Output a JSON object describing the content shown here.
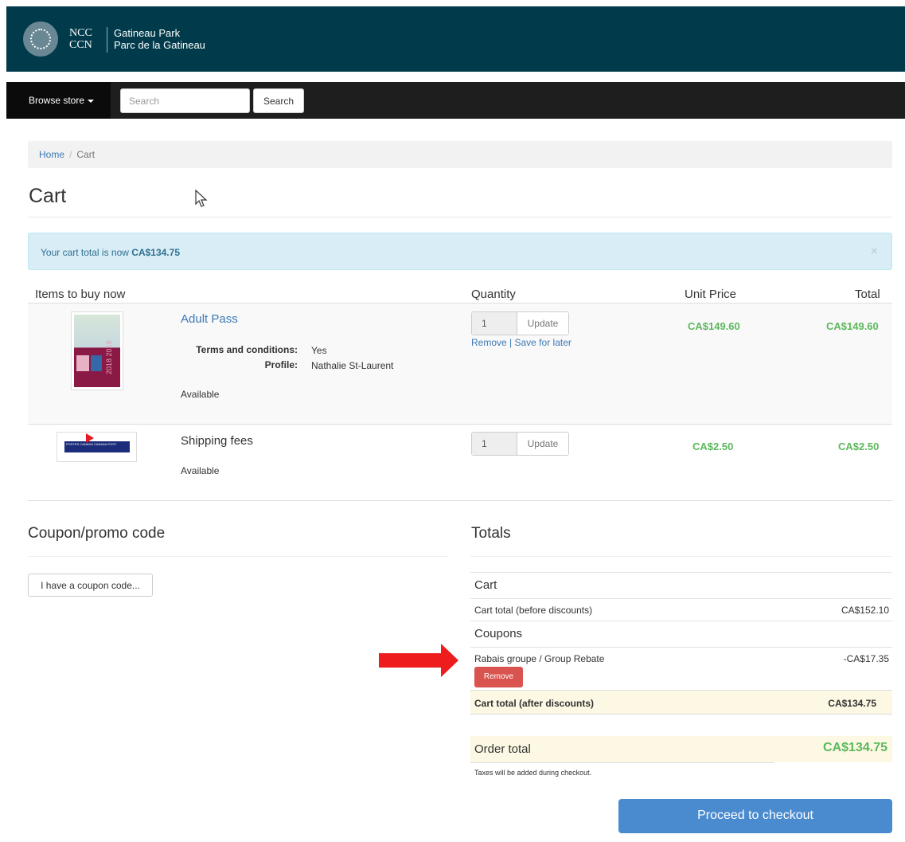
{
  "header": {
    "logo_top": "NCC",
    "logo_bottom": "CCN",
    "park_en": "Gatineau Park",
    "park_fr": "Parc de la Gatineau"
  },
  "nav": {
    "browse_label": "Browse store",
    "search_placeholder": "Search",
    "search_button": "Search"
  },
  "breadcrumb": {
    "home": "Home",
    "current": "Cart"
  },
  "page_title": "Cart",
  "alert": {
    "text": "Your cart total is now ",
    "amount": "CA$134.75",
    "close": "×"
  },
  "table": {
    "headers": {
      "items": "Items to buy now",
      "quantity": "Quantity",
      "unit_price": "Unit Price",
      "total": "Total"
    },
    "rows": [
      {
        "name": "Adult Pass",
        "attributes": [
          {
            "key": "Terms and conditions:",
            "value": "Yes"
          },
          {
            "key": "Profile:",
            "value": "Nathalie St-Laurent"
          }
        ],
        "availability": "Available",
        "quantity": "1",
        "update": "Update",
        "remove": "Remove",
        "separator": "|",
        "save_for_later": "Save for later",
        "unit_price": "CA$149.60",
        "total": "CA$149.60",
        "image_text": "2018 2019"
      },
      {
        "name": "Shipping fees",
        "availability": "Available",
        "quantity": "1",
        "update": "Update",
        "unit_price": "CA$2.50",
        "total": "CA$2.50",
        "image_text_top": "POSTES CANADA",
        "image_text_bottom": "CANADA POST"
      }
    ]
  },
  "coupon": {
    "title": "Coupon/promo code",
    "button": "I have a coupon code..."
  },
  "totals": {
    "title": "Totals",
    "cart_heading": "Cart",
    "before_label": "Cart total (before discounts)",
    "before_value": "CA$152.10",
    "coupons_heading": "Coupons",
    "coupon_name": "Rabais groupe / Group Rebate",
    "coupon_value": "-CA$17.35",
    "remove": "Remove",
    "after_label": "Cart total (after discounts)",
    "after_value": "CA$134.75",
    "order_label": "Order total",
    "order_value": "CA$134.75",
    "tax_note": "Taxes will be added during checkout.",
    "checkout": "Proceed to checkout"
  },
  "colors": {
    "header_bg": "#013b4b",
    "nav_bg": "#1e1e1e",
    "price_green": "#5cb85c",
    "link_blue": "#3b79b5",
    "remove_red": "#d9534f",
    "checkout_blue": "#4a8bcf",
    "annotation_arrow": "#ee1c1c"
  }
}
